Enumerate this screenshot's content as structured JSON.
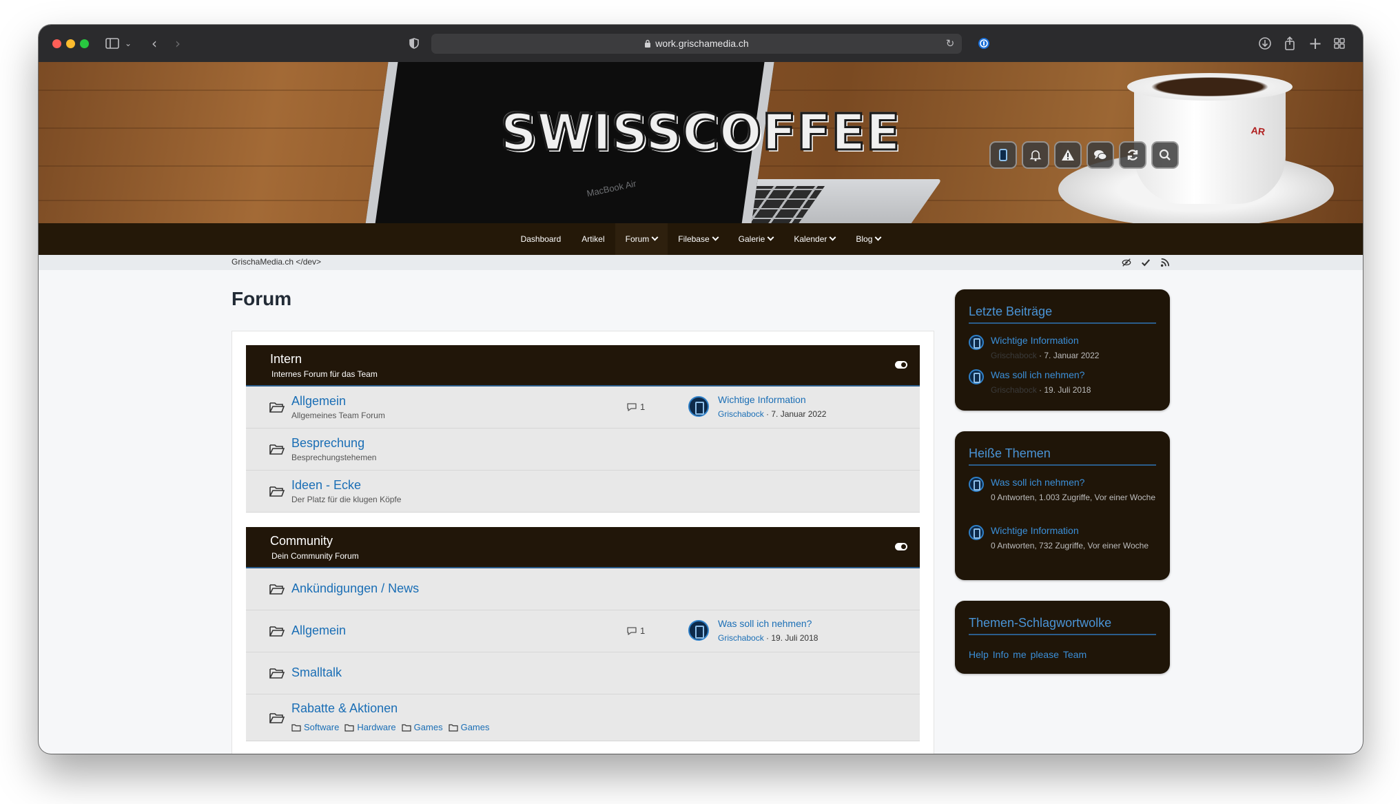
{
  "browser": {
    "url": "work.grischamedia.ch"
  },
  "header": {
    "logo_text": "SWISSCOFFEE",
    "laptop_label": "MacBook Air",
    "cup_label": "AR"
  },
  "nav": {
    "items": [
      {
        "label": "Dashboard",
        "has_menu": false
      },
      {
        "label": "Artikel",
        "has_menu": false
      },
      {
        "label": "Forum",
        "has_menu": true
      },
      {
        "label": "Filebase",
        "has_menu": true
      },
      {
        "label": "Galerie",
        "has_menu": true
      },
      {
        "label": "Kalender",
        "has_menu": true
      },
      {
        "label": "Blog",
        "has_menu": true
      }
    ]
  },
  "breadcrumb": "GrischaMedia.ch </dev>",
  "page": {
    "title": "Forum"
  },
  "sections": [
    {
      "title": "Intern",
      "subtitle": "Internes Forum für das Team",
      "boards": [
        {
          "title": "Allgemein",
          "desc": "Allgemeines Team Forum",
          "count": "1",
          "last_title": "Wichtige Information",
          "last_user": "Grischabock",
          "last_date": " · 7. Januar 2022"
        },
        {
          "title": "Besprechung",
          "desc": "Besprechungstehemen"
        },
        {
          "title": "Ideen - Ecke",
          "desc": "Der Platz für die klugen Köpfe"
        }
      ]
    },
    {
      "title": "Community",
      "subtitle": "Dein Community Forum",
      "boards": [
        {
          "title": "Ankündigungen / News"
        },
        {
          "title": "Allgemein",
          "count": "1",
          "last_title": "Was soll ich nehmen?",
          "last_user": "Grischabock",
          "last_date": " · 19. Juli 2018"
        },
        {
          "title": "Smalltalk"
        },
        {
          "title": "Rabatte & Aktionen",
          "subboards": [
            "Software",
            "Hardware",
            "Games",
            "Games"
          ]
        }
      ]
    }
  ],
  "sidebar": {
    "latest": {
      "title": "Letzte Beiträge",
      "items": [
        {
          "title": "Wichtige Information",
          "user": "Grischabock",
          "date": " · 7. Januar 2022"
        },
        {
          "title": "Was soll ich nehmen?",
          "user": "Grischabock",
          "date": " · 19. Juli 2018"
        }
      ]
    },
    "hot": {
      "title": "Heiße Themen",
      "items": [
        {
          "title": "Was soll ich nehmen?",
          "meta": "0 Antworten, 1.003 Zugriffe, Vor einer Woche"
        },
        {
          "title": "Wichtige Information",
          "meta": "0 Antworten, 732 Zugriffe, Vor einer Woche"
        }
      ]
    },
    "tags": {
      "title": "Themen-Schlagwortwolke",
      "items": [
        "Help",
        "Info",
        "me",
        "please",
        "Team"
      ]
    }
  }
}
